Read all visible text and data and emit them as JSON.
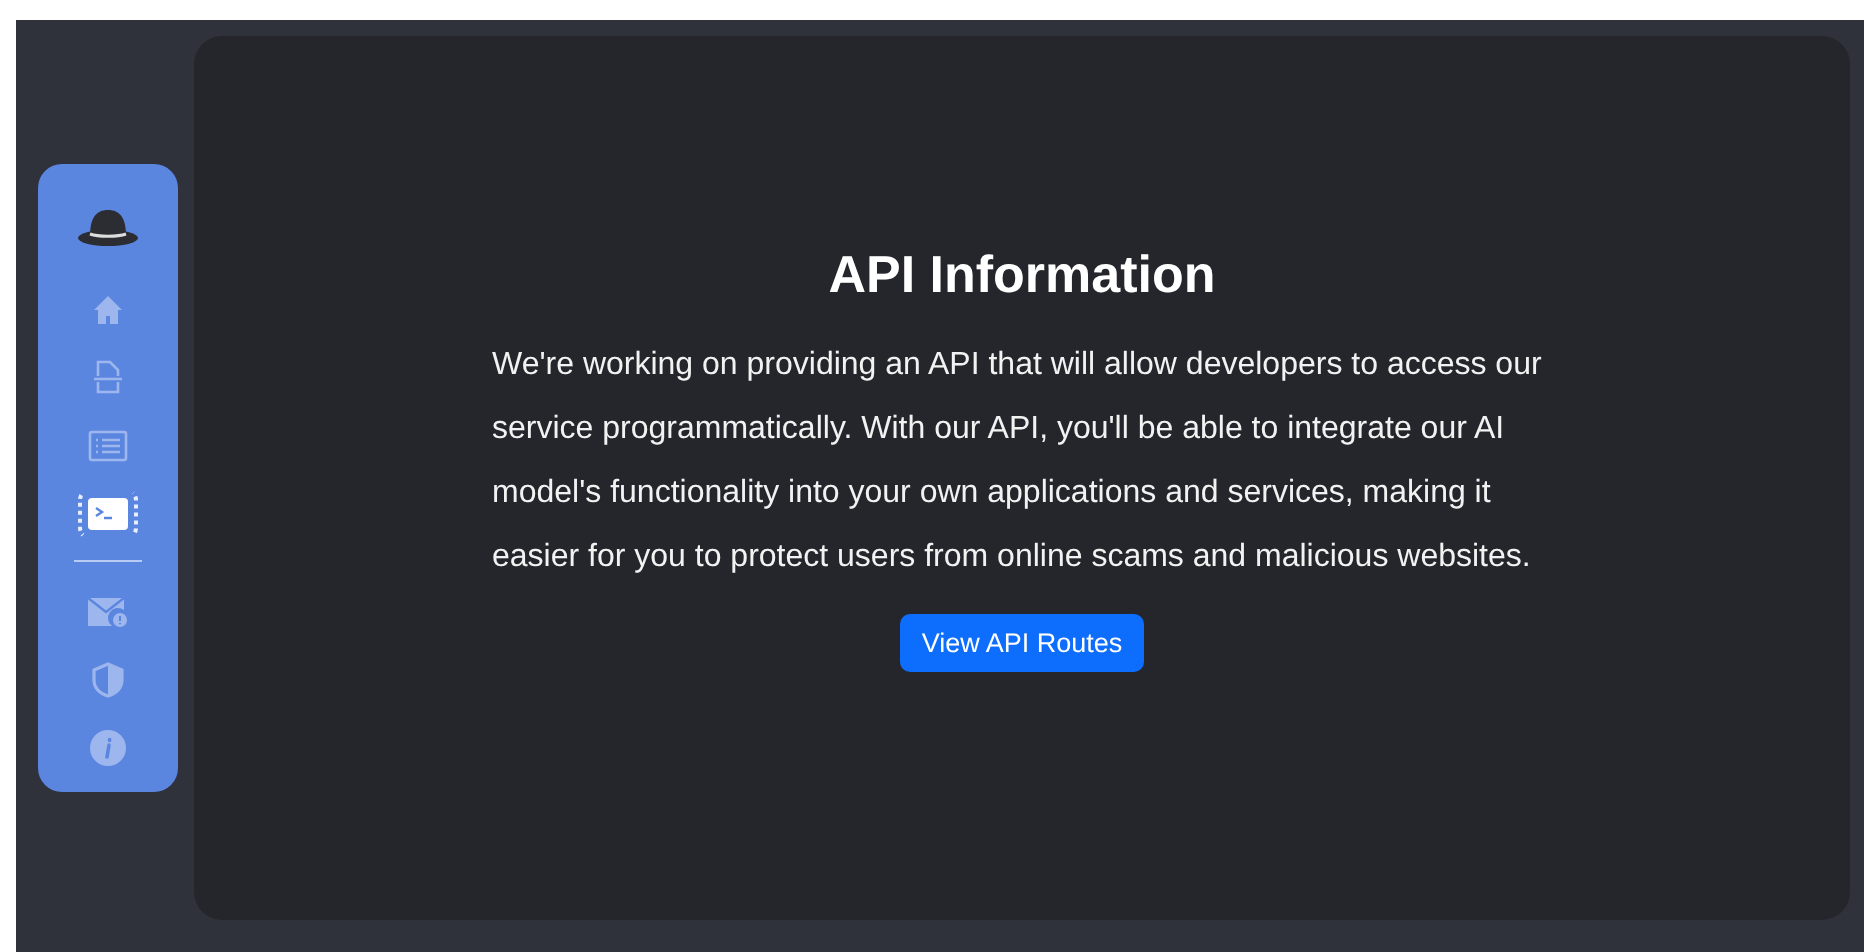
{
  "sidebar": {
    "groups": [
      [
        {
          "selected": false
        },
        {
          "selected": false
        },
        {
          "selected": false
        },
        {
          "selected": true
        }
      ],
      [
        {
          "selected": false
        },
        {
          "selected": false
        },
        {
          "selected": false
        }
      ]
    ]
  },
  "content": {
    "title": "API Information",
    "body": "We're working on providing an API that will allow developers to access our service programmatically. With our API, you'll be able to integrate our AI model's functionality into your own applications and services, making it easier for you to protect users from online scams and malicious websites.",
    "button": "View API Routes"
  }
}
